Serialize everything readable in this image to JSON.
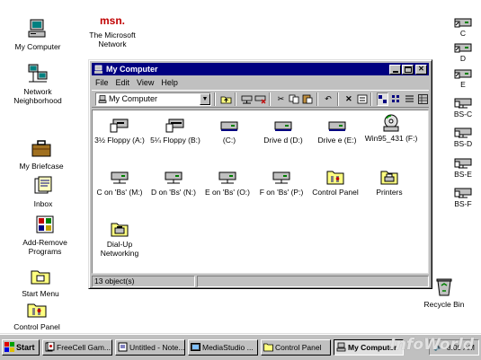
{
  "desktop": {
    "left_icons": [
      {
        "label": "My Computer"
      },
      {
        "label": "Network Neighborhood"
      },
      {
        "label": "My Briefcase"
      },
      {
        "label": "Inbox"
      },
      {
        "label": "Add-Remove Programs"
      },
      {
        "label": "Start Menu"
      },
      {
        "label": "Control Panel"
      }
    ],
    "msn": {
      "logo": "msn.",
      "label": "The Microsoft Network"
    },
    "right_icons": [
      {
        "label": "C"
      },
      {
        "label": "D"
      },
      {
        "label": "E"
      },
      {
        "label": "BS-C"
      },
      {
        "label": "BS-D"
      },
      {
        "label": "BS-E"
      },
      {
        "label": "BS-F"
      }
    ],
    "recycle_bin": {
      "label": "Recycle Bin"
    }
  },
  "window": {
    "title": "My Computer",
    "menu": [
      {
        "label": "File"
      },
      {
        "label": "Edit"
      },
      {
        "label": "View"
      },
      {
        "label": "Help"
      }
    ],
    "address": "My Computer",
    "items": [
      {
        "label": "3½ Floppy (A:)",
        "icon": "floppy-drive-icon"
      },
      {
        "label": "5¼ Floppy (B:)",
        "icon": "floppy-drive-icon"
      },
      {
        "label": "(C:)",
        "icon": "hard-drive-icon"
      },
      {
        "label": "Drive d (D:)",
        "icon": "hard-drive-icon"
      },
      {
        "label": "Drive e (E:)",
        "icon": "hard-drive-icon"
      },
      {
        "label": "Win95_431 (F:)",
        "icon": "cdrom-icon"
      },
      {
        "label": "C on 'Bs' (M:)",
        "icon": "network-drive-icon"
      },
      {
        "label": "D on 'Bs' (N:)",
        "icon": "network-drive-icon"
      },
      {
        "label": "E on 'Bs' (O:)",
        "icon": "network-drive-icon"
      },
      {
        "label": "F on 'Bs' (P:)",
        "icon": "network-drive-icon"
      },
      {
        "label": "Control Panel",
        "icon": "folder-icon"
      },
      {
        "label": "Printers",
        "icon": "folder-icon"
      },
      {
        "label": "Dial-Up Networking",
        "icon": "folder-icon"
      }
    ],
    "status": "13 object(s)"
  },
  "taskbar": {
    "start": "Start",
    "tasks": [
      {
        "label": "FreeCell Gam..."
      },
      {
        "label": "Untitled - Note..."
      },
      {
        "label": "MediaStudio ..."
      },
      {
        "label": "Control Panel"
      },
      {
        "label": "My Computer"
      }
    ],
    "clock": "8:09 AM"
  },
  "watermark": "InfoWorld",
  "colors": {
    "titlebar": "#000080",
    "face": "#c0c0c0",
    "desktop": "#ffffff"
  }
}
